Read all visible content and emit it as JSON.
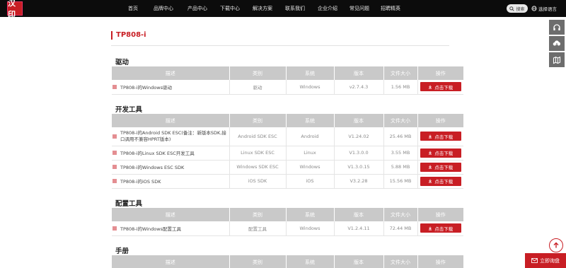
{
  "nav": {
    "items": [
      "首页",
      "品牌中心",
      "产品中心",
      "下载中心",
      "解决方案",
      "联系我们",
      "企业介绍",
      "常见问题",
      "招聘精英"
    ],
    "search_label": "搜索",
    "language_label": "选择语言"
  },
  "logo_text": "汉印",
  "page_title": "TP808-i",
  "columns": [
    "描述",
    "类别",
    "系统",
    "版本",
    "文件大小",
    "操作"
  ],
  "download_label": "点击下载",
  "sections": [
    {
      "heading": "驱动",
      "rows": [
        {
          "desc": "TP808-i的Windows驱动",
          "category": "驱动",
          "system": "Windows",
          "version": "v2.7.4.3",
          "size": "1.56 MB"
        }
      ]
    },
    {
      "heading": "开发工具",
      "rows": [
        {
          "desc": "TP808-i的Android SDK ESC(备注：新版本SDK,接口调用不兼容HPRT版本)",
          "category": "Android SDK ESC",
          "system": "Android",
          "version": "V1.24.02",
          "size": "25.46 MB"
        },
        {
          "desc": "TP808-i的Linux SDK ESC开发工具",
          "category": "Linux SDK ESC",
          "system": "Linux",
          "version": "V1.3.0.0",
          "size": "3.55 MB"
        },
        {
          "desc": "TP808-i的Windows ESC SDK",
          "category": "Windows SDK ESC",
          "system": "Windows",
          "version": "V1.3.0.15",
          "size": "5.88 MB"
        },
        {
          "desc": "TP808-i的iOS SDK",
          "category": "iOS SDK",
          "system": "iOS",
          "version": "V3.2.28",
          "size": "15.56 MB"
        }
      ]
    },
    {
      "heading": "配置工具",
      "rows": [
        {
          "desc": "TP808-i的Windows配置工具",
          "category": "配置工具",
          "system": "Windows",
          "version": "V1.2.4.11",
          "size": "72.44 MB"
        }
      ]
    },
    {
      "heading": "手册",
      "rows": []
    }
  ],
  "consult_label": "立即询盘",
  "colors": {
    "accent": "#c81e24",
    "header_bg": "#0c0c0c",
    "table_head": "#c9c9c9"
  }
}
